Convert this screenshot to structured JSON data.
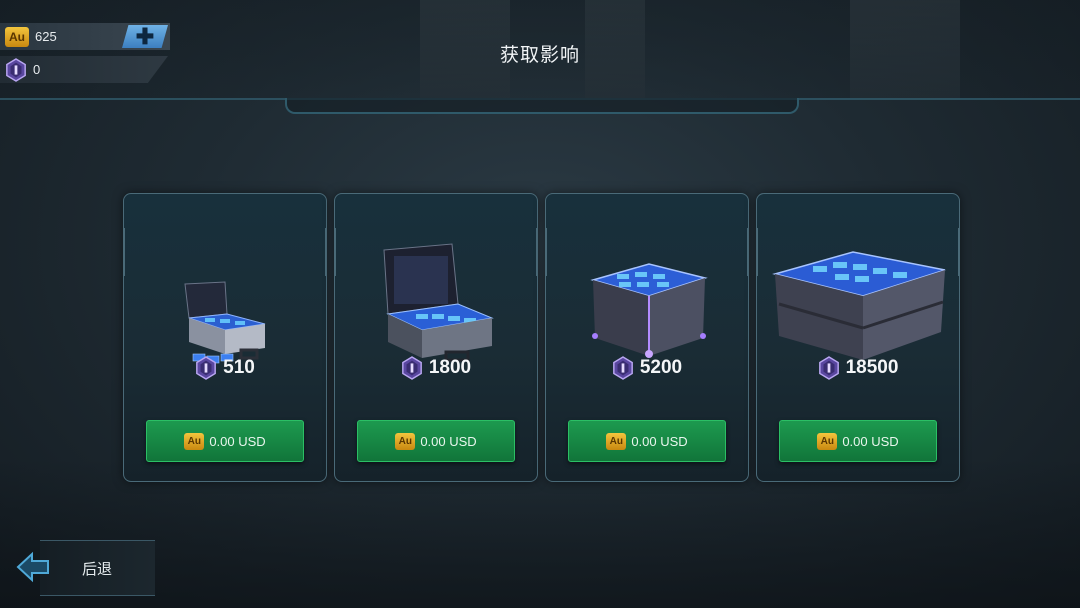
{
  "header": {
    "title": "获取影响"
  },
  "currencies": {
    "gold": {
      "icon": "au-icon",
      "icon_text": "Au",
      "value": "625"
    },
    "influence": {
      "icon": "influence-icon",
      "value": "0"
    },
    "add_icon": "plus-icon"
  },
  "packs": [
    {
      "amount": "510",
      "price": "0.00 USD",
      "price_icon_text": "Au"
    },
    {
      "amount": "1800",
      "price": "0.00 USD",
      "price_icon_text": "Au"
    },
    {
      "amount": "5200",
      "price": "0.00 USD",
      "price_icon_text": "Au"
    },
    {
      "amount": "18500",
      "price": "0.00 USD",
      "price_icon_text": "Au"
    }
  ],
  "footer": {
    "back_label": "后退",
    "back_icon": "back-arrow-icon"
  },
  "colors": {
    "buy_green": "#1d9a4f",
    "gold": "#f3c53d",
    "influence_purple": "#7c5fc4",
    "frame": "#4a6a78"
  }
}
